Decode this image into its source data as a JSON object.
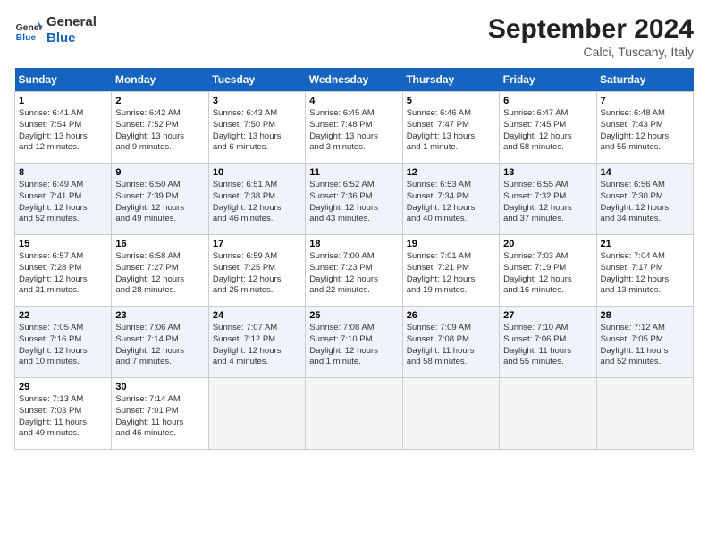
{
  "header": {
    "logo_line1": "General",
    "logo_line2": "Blue",
    "month": "September 2024",
    "location": "Calci, Tuscany, Italy"
  },
  "weekdays": [
    "Sunday",
    "Monday",
    "Tuesday",
    "Wednesday",
    "Thursday",
    "Friday",
    "Saturday"
  ],
  "weeks": [
    [
      {
        "day": "1",
        "info": "Sunrise: 6:41 AM\nSunset: 7:54 PM\nDaylight: 13 hours\nand 12 minutes."
      },
      {
        "day": "2",
        "info": "Sunrise: 6:42 AM\nSunset: 7:52 PM\nDaylight: 13 hours\nand 9 minutes."
      },
      {
        "day": "3",
        "info": "Sunrise: 6:43 AM\nSunset: 7:50 PM\nDaylight: 13 hours\nand 6 minutes."
      },
      {
        "day": "4",
        "info": "Sunrise: 6:45 AM\nSunset: 7:48 PM\nDaylight: 13 hours\nand 3 minutes."
      },
      {
        "day": "5",
        "info": "Sunrise: 6:46 AM\nSunset: 7:47 PM\nDaylight: 13 hours\nand 1 minute."
      },
      {
        "day": "6",
        "info": "Sunrise: 6:47 AM\nSunset: 7:45 PM\nDaylight: 12 hours\nand 58 minutes."
      },
      {
        "day": "7",
        "info": "Sunrise: 6:48 AM\nSunset: 7:43 PM\nDaylight: 12 hours\nand 55 minutes."
      }
    ],
    [
      {
        "day": "8",
        "info": "Sunrise: 6:49 AM\nSunset: 7:41 PM\nDaylight: 12 hours\nand 52 minutes."
      },
      {
        "day": "9",
        "info": "Sunrise: 6:50 AM\nSunset: 7:39 PM\nDaylight: 12 hours\nand 49 minutes."
      },
      {
        "day": "10",
        "info": "Sunrise: 6:51 AM\nSunset: 7:38 PM\nDaylight: 12 hours\nand 46 minutes."
      },
      {
        "day": "11",
        "info": "Sunrise: 6:52 AM\nSunset: 7:36 PM\nDaylight: 12 hours\nand 43 minutes."
      },
      {
        "day": "12",
        "info": "Sunrise: 6:53 AM\nSunset: 7:34 PM\nDaylight: 12 hours\nand 40 minutes."
      },
      {
        "day": "13",
        "info": "Sunrise: 6:55 AM\nSunset: 7:32 PM\nDaylight: 12 hours\nand 37 minutes."
      },
      {
        "day": "14",
        "info": "Sunrise: 6:56 AM\nSunset: 7:30 PM\nDaylight: 12 hours\nand 34 minutes."
      }
    ],
    [
      {
        "day": "15",
        "info": "Sunrise: 6:57 AM\nSunset: 7:28 PM\nDaylight: 12 hours\nand 31 minutes."
      },
      {
        "day": "16",
        "info": "Sunrise: 6:58 AM\nSunset: 7:27 PM\nDaylight: 12 hours\nand 28 minutes."
      },
      {
        "day": "17",
        "info": "Sunrise: 6:59 AM\nSunset: 7:25 PM\nDaylight: 12 hours\nand 25 minutes."
      },
      {
        "day": "18",
        "info": "Sunrise: 7:00 AM\nSunset: 7:23 PM\nDaylight: 12 hours\nand 22 minutes."
      },
      {
        "day": "19",
        "info": "Sunrise: 7:01 AM\nSunset: 7:21 PM\nDaylight: 12 hours\nand 19 minutes."
      },
      {
        "day": "20",
        "info": "Sunrise: 7:03 AM\nSunset: 7:19 PM\nDaylight: 12 hours\nand 16 minutes."
      },
      {
        "day": "21",
        "info": "Sunrise: 7:04 AM\nSunset: 7:17 PM\nDaylight: 12 hours\nand 13 minutes."
      }
    ],
    [
      {
        "day": "22",
        "info": "Sunrise: 7:05 AM\nSunset: 7:16 PM\nDaylight: 12 hours\nand 10 minutes."
      },
      {
        "day": "23",
        "info": "Sunrise: 7:06 AM\nSunset: 7:14 PM\nDaylight: 12 hours\nand 7 minutes."
      },
      {
        "day": "24",
        "info": "Sunrise: 7:07 AM\nSunset: 7:12 PM\nDaylight: 12 hours\nand 4 minutes."
      },
      {
        "day": "25",
        "info": "Sunrise: 7:08 AM\nSunset: 7:10 PM\nDaylight: 12 hours\nand 1 minute."
      },
      {
        "day": "26",
        "info": "Sunrise: 7:09 AM\nSunset: 7:08 PM\nDaylight: 11 hours\nand 58 minutes."
      },
      {
        "day": "27",
        "info": "Sunrise: 7:10 AM\nSunset: 7:06 PM\nDaylight: 11 hours\nand 55 minutes."
      },
      {
        "day": "28",
        "info": "Sunrise: 7:12 AM\nSunset: 7:05 PM\nDaylight: 11 hours\nand 52 minutes."
      }
    ],
    [
      {
        "day": "29",
        "info": "Sunrise: 7:13 AM\nSunset: 7:03 PM\nDaylight: 11 hours\nand 49 minutes."
      },
      {
        "day": "30",
        "info": "Sunrise: 7:14 AM\nSunset: 7:01 PM\nDaylight: 11 hours\nand 46 minutes."
      },
      {
        "day": "",
        "info": ""
      },
      {
        "day": "",
        "info": ""
      },
      {
        "day": "",
        "info": ""
      },
      {
        "day": "",
        "info": ""
      },
      {
        "day": "",
        "info": ""
      }
    ]
  ]
}
